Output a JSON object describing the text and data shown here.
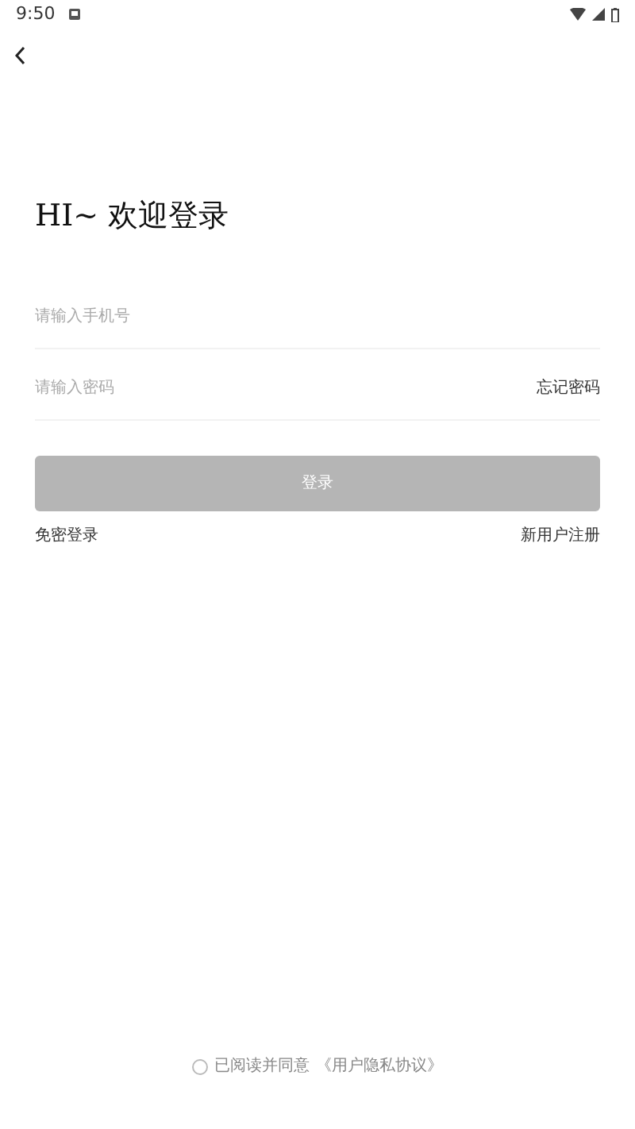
{
  "status_bar": {
    "time": "9:50"
  },
  "title": "HI~ 欢迎登录",
  "phone_field": {
    "placeholder": "请输入手机号"
  },
  "password_field": {
    "placeholder": "请输入密码",
    "forgot_link": "忘记密码"
  },
  "login_button": {
    "label": "登录",
    "disabled": true
  },
  "links": {
    "left": "免密登录",
    "right": "新用户注册"
  },
  "agreement": {
    "checked": false,
    "text": "已阅读并同意",
    "link": "《用户隐私协议》"
  }
}
